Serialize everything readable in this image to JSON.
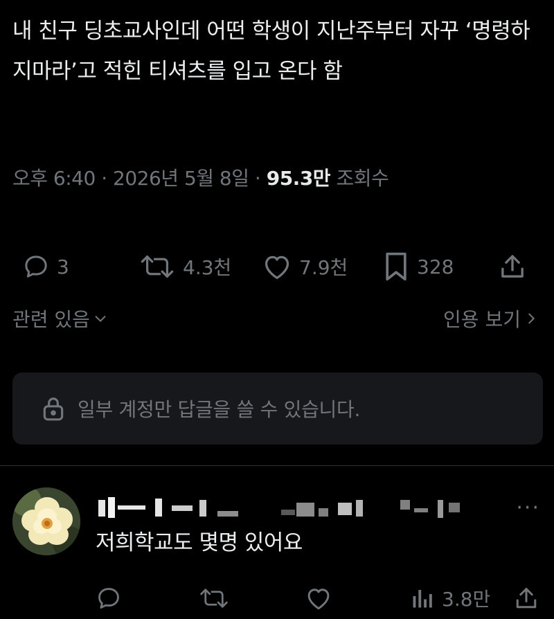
{
  "tweet": {
    "text": "내 친구 딩초교사인데 어떤 학생이 지난주부터 자꾸 ‘명령하지마라’고 적힌 티셔츠를 입고 온다 함",
    "time": "오후 6:40",
    "date": "2026년 5월 8일",
    "views": "95.3만",
    "views_label": "조회수",
    "separator": "·"
  },
  "actions": {
    "replies": "3",
    "retweets": "4.3천",
    "likes": "7.9천",
    "bookmarks": "328"
  },
  "related": {
    "label": "관련 있음",
    "quotes_label": "인용 보기"
  },
  "reply_restriction": {
    "message": "일부 계정만 답글을 쓸 수 있습니다."
  },
  "reply": {
    "text": "저희학교도 몇명 있어요",
    "more": "···",
    "views": "3.8만"
  },
  "colors": {
    "background": "#000000",
    "text": "#e7e9ea",
    "muted": "#71767b",
    "panel": "#16181c"
  },
  "icons": [
    "reply-icon",
    "retweet-icon",
    "like-icon",
    "bookmark-icon",
    "share-icon",
    "chevron-down-icon",
    "chevron-right-icon",
    "lock-icon",
    "views-icon"
  ]
}
